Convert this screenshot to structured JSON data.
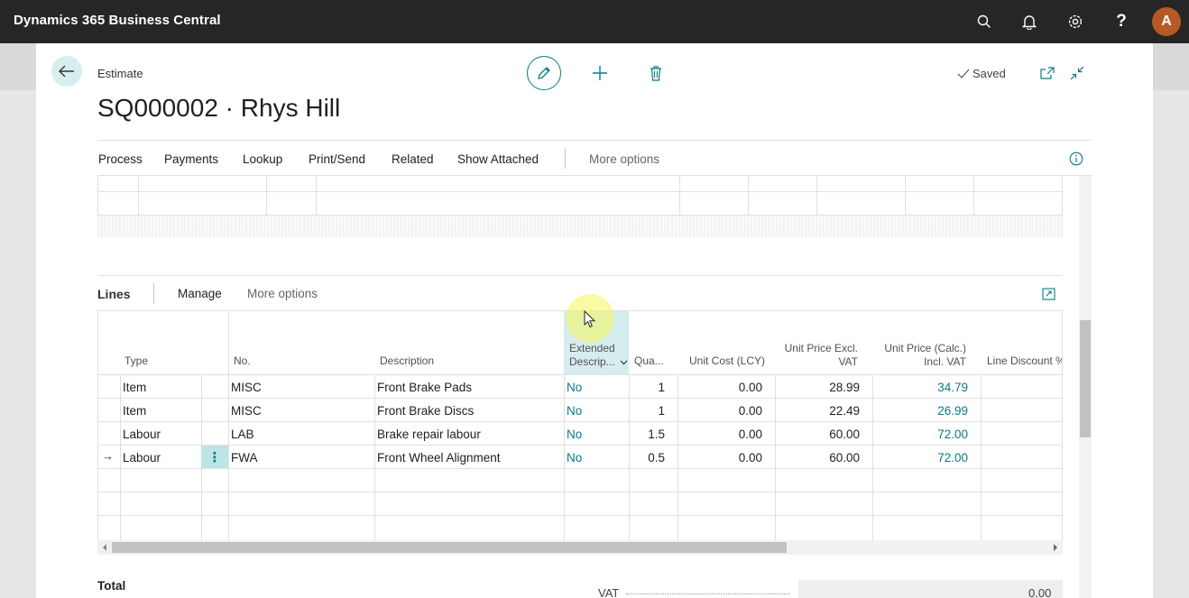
{
  "app": {
    "title": "Dynamics 365 Business Central",
    "user_initial": "A"
  },
  "page": {
    "breadcrumb": "Estimate",
    "title": "SQ000002 · Rhys Hill",
    "status": "Saved"
  },
  "menu": {
    "items": [
      "Process",
      "Payments",
      "Lookup",
      "Print/Send",
      "Related",
      "Show Attached"
    ],
    "more": "More options"
  },
  "lines": {
    "title": "Lines",
    "manage": "Manage",
    "more": "More options",
    "columns": {
      "type": "Type",
      "no": "No.",
      "description": "Description",
      "extended_1": "Extended",
      "extended_2": "Descrip...",
      "quantity": "Qua...",
      "unit_cost": "Unit Cost (LCY)",
      "price_excl_1": "Unit Price Excl.",
      "price_excl_2": "VAT",
      "price_incl_1": "Unit Price (Calc.)",
      "price_incl_2": "Incl. VAT",
      "line_discount": "Line Discount %"
    },
    "rows": [
      {
        "type": "Item",
        "no": "MISC",
        "description": "Front Brake Pads",
        "extended": "No",
        "quantity": "1",
        "unit_cost": "0.00",
        "price_excl": "28.99",
        "price_incl": "34.79"
      },
      {
        "type": "Item",
        "no": "MISC",
        "description": "Front Brake Discs",
        "extended": "No",
        "quantity": "1",
        "unit_cost": "0.00",
        "price_excl": "22.49",
        "price_incl": "26.99"
      },
      {
        "type": "Labour",
        "no": "LAB",
        "description": "Brake repair labour",
        "extended": "No",
        "quantity": "1.5",
        "unit_cost": "0.00",
        "price_excl": "60.00",
        "price_incl": "72.00"
      },
      {
        "type": "Labour",
        "no": "FWA",
        "description": "Front Wheel Alignment",
        "extended": "No",
        "quantity": "0.5",
        "unit_cost": "0.00",
        "price_excl": "60.00",
        "price_incl": "72.00"
      }
    ],
    "current_row_marker": "→",
    "row_menu_glyph": "⋮"
  },
  "totals": {
    "label": "Total",
    "vat_label": "VAT",
    "vat_value": "0.00"
  },
  "colors": {
    "accent": "#0a7a82",
    "topbar": "#262626",
    "avatar": "#b55a24"
  },
  "icons": [
    "search-icon",
    "bell-icon",
    "gear-icon",
    "help-icon",
    "back-arrow-icon",
    "edit-icon",
    "plus-icon",
    "delete-icon",
    "check-icon",
    "open-new-window-icon",
    "collapse-icon",
    "info-icon",
    "expand-icon",
    "chevron-down-icon"
  ]
}
